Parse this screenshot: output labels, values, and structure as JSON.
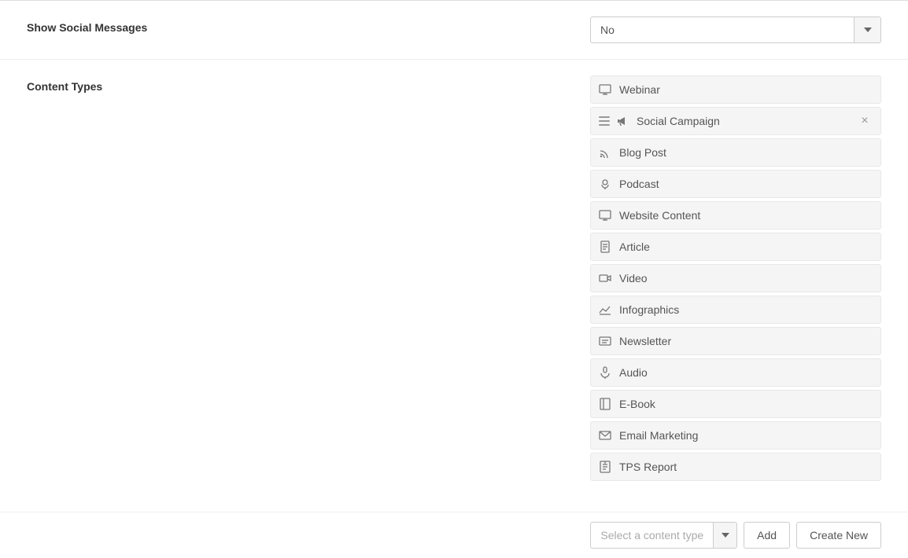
{
  "page": {
    "show_social_messages": {
      "label": "Show Social Messages",
      "value": "No",
      "arrow_unicode": "▾"
    },
    "content_types": {
      "label": "Content Types",
      "items": [
        {
          "id": "webinar",
          "label": "Webinar",
          "icon": "webinar",
          "removable": false,
          "draggable": false
        },
        {
          "id": "social-campaign",
          "label": "Social Campaign",
          "icon": "megaphone",
          "removable": true,
          "draggable": true
        },
        {
          "id": "blog-post",
          "label": "Blog Post",
          "icon": "rss",
          "removable": false,
          "draggable": false
        },
        {
          "id": "podcast",
          "label": "Podcast",
          "icon": "podcast",
          "removable": false,
          "draggable": false
        },
        {
          "id": "website-content",
          "label": "Website Content",
          "icon": "monitor",
          "removable": false,
          "draggable": false
        },
        {
          "id": "article",
          "label": "Article",
          "icon": "article",
          "removable": false,
          "draggable": false
        },
        {
          "id": "video",
          "label": "Video",
          "icon": "video",
          "removable": false,
          "draggable": false
        },
        {
          "id": "infographics",
          "label": "Infographics",
          "icon": "chart",
          "removable": false,
          "draggable": false
        },
        {
          "id": "newsletter",
          "label": "Newsletter",
          "icon": "newsletter",
          "removable": false,
          "draggable": false
        },
        {
          "id": "audio",
          "label": "Audio",
          "icon": "mic",
          "removable": false,
          "draggable": false
        },
        {
          "id": "ebook",
          "label": "E-Book",
          "icon": "book",
          "removable": false,
          "draggable": false
        },
        {
          "id": "email-marketing",
          "label": "Email Marketing",
          "icon": "email",
          "removable": false,
          "draggable": false
        },
        {
          "id": "tps-report",
          "label": "TPS Report",
          "icon": "tps",
          "removable": false,
          "draggable": false
        }
      ]
    },
    "bottom_bar": {
      "select_placeholder": "Select a content type",
      "add_label": "Add",
      "create_new_label": "Create New"
    }
  }
}
